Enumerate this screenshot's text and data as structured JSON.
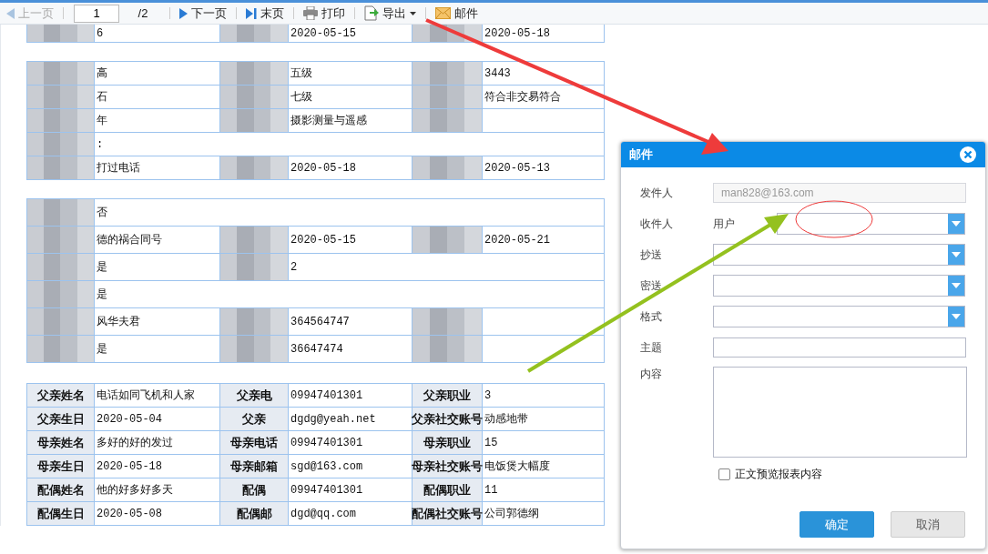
{
  "toolbar": {
    "items": [
      {
        "kind": "prev",
        "label": "上一页",
        "disabled": true
      },
      {
        "kind": "page",
        "value": "1",
        "total": "/2"
      },
      {
        "kind": "next",
        "label": "下一页",
        "disabled": false
      },
      {
        "kind": "last",
        "label": "末页",
        "disabled": false
      },
      {
        "kind": "print",
        "label": "打印",
        "disabled": false
      },
      {
        "kind": "export",
        "label": "导出",
        "disabled": false
      },
      {
        "kind": "mail",
        "label": "邮件",
        "disabled": false
      }
    ]
  },
  "sections": [
    {
      "rows": [
        [
          {
            "kind": "redacted"
          },
          {
            "kind": "value",
            "text": "6"
          },
          {
            "kind": "redacted"
          },
          {
            "kind": "value",
            "text": "2020-05-15"
          },
          {
            "kind": "redacted"
          },
          {
            "kind": "value",
            "text": "2020-05-18"
          }
        ]
      ]
    },
    {
      "rows": [
        [
          {
            "kind": "redacted"
          },
          {
            "kind": "value",
            "text": "高"
          },
          {
            "kind": "redacted"
          },
          {
            "kind": "value",
            "text": "五级"
          },
          {
            "kind": "redacted"
          },
          {
            "kind": "value",
            "text": "3443"
          }
        ],
        [
          {
            "kind": "redacted"
          },
          {
            "kind": "value",
            "text": "石"
          },
          {
            "kind": "redacted"
          },
          {
            "kind": "value",
            "text": "七级"
          },
          {
            "kind": "redacted"
          },
          {
            "kind": "value",
            "text": "符合非交易符合"
          }
        ],
        [
          {
            "kind": "redacted"
          },
          {
            "kind": "value",
            "text": "年"
          },
          {
            "kind": "redacted"
          },
          {
            "kind": "value",
            "text": "摄影测量与遥感"
          },
          {
            "kind": "redacted"
          },
          {
            "kind": "blank"
          }
        ],
        [
          {
            "kind": "redacted"
          },
          {
            "kind": "wide",
            "text": ":"
          }
        ],
        [
          {
            "kind": "redacted"
          },
          {
            "kind": "value",
            "text": "打过电话"
          },
          {
            "kind": "redacted"
          },
          {
            "kind": "value",
            "text": "2020-05-18"
          },
          {
            "kind": "redacted"
          },
          {
            "kind": "value",
            "text": "2020-05-13"
          }
        ]
      ]
    },
    {
      "rows": [
        [
          {
            "kind": "redacted"
          },
          {
            "kind": "wide",
            "text": "否"
          }
        ],
        [
          {
            "kind": "redacted"
          },
          {
            "kind": "value",
            "text": "德的祸合同号"
          },
          {
            "kind": "redacted"
          },
          {
            "kind": "value",
            "text": "2020-05-15"
          },
          {
            "kind": "redacted"
          },
          {
            "kind": "value",
            "text": "2020-05-21"
          }
        ],
        [
          {
            "kind": "redacted"
          },
          {
            "kind": "value",
            "text": "是"
          },
          {
            "kind": "redacted"
          },
          {
            "kind": "wide",
            "text": "2"
          }
        ],
        [
          {
            "kind": "redacted"
          },
          {
            "kind": "wide",
            "text": "是"
          }
        ],
        [
          {
            "kind": "redacted"
          },
          {
            "kind": "value",
            "text": "风华夫君"
          },
          {
            "kind": "redacted"
          },
          {
            "kind": "value",
            "text": "364564747"
          },
          {
            "kind": "redacted"
          },
          {
            "kind": "blank"
          }
        ],
        [
          {
            "kind": "redacted"
          },
          {
            "kind": "value",
            "text": "是"
          },
          {
            "kind": "redacted"
          },
          {
            "kind": "value",
            "text": "36647474"
          },
          {
            "kind": "redacted"
          },
          {
            "kind": "blank"
          }
        ]
      ]
    },
    {
      "rows": [
        [
          {
            "kind": "label",
            "text": "父亲姓名"
          },
          {
            "kind": "value",
            "text": "电话如同飞机和人家"
          },
          {
            "kind": "label",
            "text": "父亲电"
          },
          {
            "kind": "value",
            "text": "09947401301"
          },
          {
            "kind": "label",
            "text": "父亲职业"
          },
          {
            "kind": "value",
            "text": "3"
          }
        ],
        [
          {
            "kind": "label",
            "text": "父亲生日"
          },
          {
            "kind": "value",
            "text": "2020-05-04"
          },
          {
            "kind": "label",
            "text": "父亲"
          },
          {
            "kind": "value",
            "text": "dgdg@yeah.net"
          },
          {
            "kind": "label",
            "text": "父亲社交账号"
          },
          {
            "kind": "value",
            "text": "动感地带"
          }
        ],
        [
          {
            "kind": "label",
            "text": "母亲姓名"
          },
          {
            "kind": "value",
            "text": "多好的好的发过"
          },
          {
            "kind": "label",
            "text": "母亲电话"
          },
          {
            "kind": "value",
            "text": "09947401301"
          },
          {
            "kind": "label",
            "text": "母亲职业"
          },
          {
            "kind": "value",
            "text": "15"
          }
        ],
        [
          {
            "kind": "label",
            "text": "母亲生日"
          },
          {
            "kind": "value",
            "text": "2020-05-18"
          },
          {
            "kind": "label",
            "text": "母亲邮箱"
          },
          {
            "kind": "value",
            "text": "sgd@163.com"
          },
          {
            "kind": "label",
            "text": "母亲社交账号"
          },
          {
            "kind": "value",
            "text": "电饭煲大幅度"
          }
        ],
        [
          {
            "kind": "label",
            "text": "配偶姓名"
          },
          {
            "kind": "value",
            "text": "他的好多好多天"
          },
          {
            "kind": "label",
            "text": "配偶"
          },
          {
            "kind": "value",
            "text": "09947401301"
          },
          {
            "kind": "label",
            "text": "配偶职业"
          },
          {
            "kind": "value",
            "text": "11"
          }
        ],
        [
          {
            "kind": "label",
            "text": "配偶生日"
          },
          {
            "kind": "value",
            "text": "2020-05-08"
          },
          {
            "kind": "label",
            "text": "配偶邮"
          },
          {
            "kind": "value",
            "text": "dgd@qq.com"
          },
          {
            "kind": "label",
            "text": "配偶社交账号"
          },
          {
            "kind": "value",
            "text": "公司郭德纲"
          }
        ]
      ]
    }
  ],
  "dialog": {
    "title": "邮件",
    "fields": [
      {
        "kind": "text",
        "label": "发件人",
        "value": "man828@163.com",
        "disabled": true
      },
      {
        "kind": "select",
        "label": "收件人",
        "prefix": "用户"
      },
      {
        "kind": "select",
        "label": "抄送"
      },
      {
        "kind": "select",
        "label": "密送"
      },
      {
        "kind": "select",
        "label": "格式"
      },
      {
        "kind": "text",
        "label": "主题",
        "disabled": false
      },
      {
        "kind": "textarea",
        "label": "内容"
      }
    ],
    "checkbox": {
      "label": "正文预览报表内容",
      "checked": false
    },
    "buttons": [
      {
        "kind": "primary",
        "label": "确定"
      },
      {
        "kind": "secondary",
        "label": "取消"
      }
    ]
  }
}
